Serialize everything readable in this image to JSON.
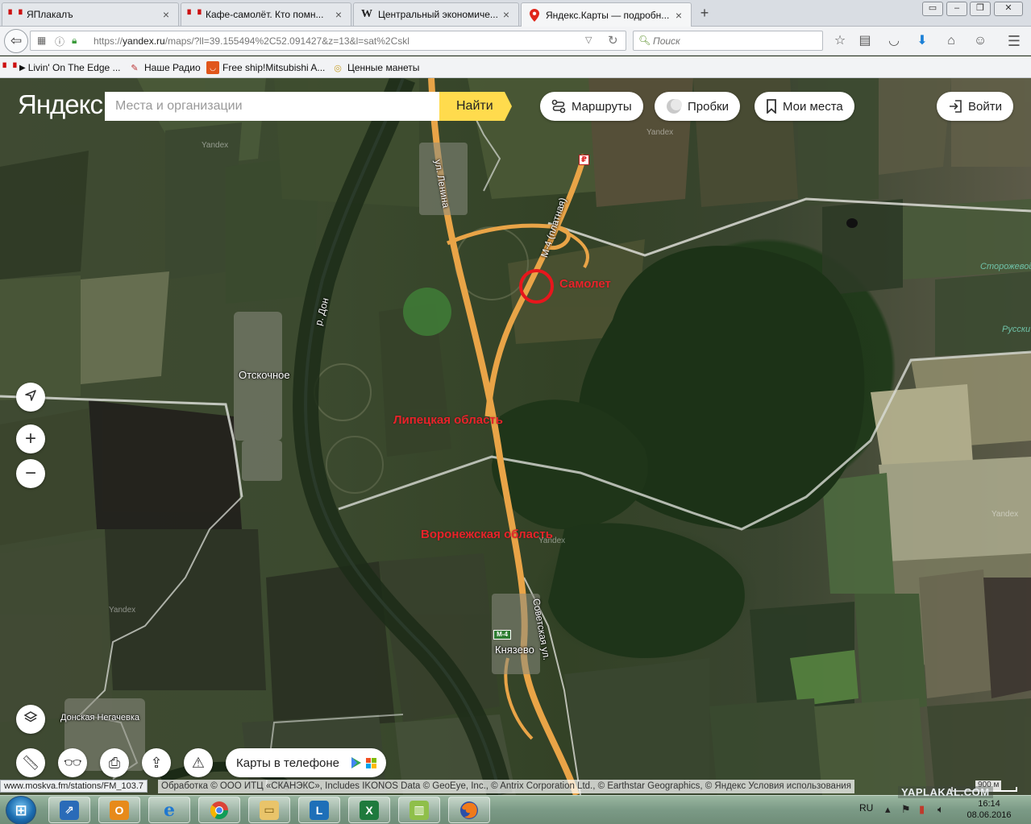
{
  "browser": {
    "tabs": [
      {
        "label": "ЯПлакалъ",
        "fav": "Я"
      },
      {
        "label": "Кафе-самолёт. Кто помн...",
        "fav": "Я"
      },
      {
        "label": "Центральный экономиче...",
        "fav": "W"
      },
      {
        "label": "Яндекс.Карты — подробн...",
        "fav": "pin",
        "active": true
      }
    ],
    "new_tab": "+",
    "url": "https://yandex.ru/maps/?ll=39.155494%2C52.091427&z=13&l=sat%2Cskl",
    "url_prefix": "https://",
    "url_domain": "yandex.ru",
    "url_rest": "/maps/?ll=39.155494%2C52.091427&z=13&l=sat%2Cskl",
    "search_placeholder": "Поиск",
    "bookmarks": [
      {
        "label": "Livin' On The Edge ..."
      },
      {
        "label": "Наше Радио"
      },
      {
        "label": "Free ship!Mitsubishi A..."
      },
      {
        "label": "Ценные манеты"
      }
    ]
  },
  "map": {
    "logo": "Яндекс",
    "search_placeholder": "Места и организации",
    "find_label": "Найти",
    "routes_label": "Маршруты",
    "traffic_label": "Пробки",
    "myplaces_label": "Мои места",
    "login_label": "Войти",
    "phone_label": "Карты в телефоне",
    "labels": {
      "lenina": "ул. Ленина",
      "m4": "М-4 (платная)",
      "samolet": "Самолет",
      "don": "р. Дон",
      "otskochnoe": "Отскочное",
      "lipetsk": "Липецкая область",
      "voronezh": "Воронежская область",
      "sovetskaya": "Советская ул.",
      "knyazevo": "Князево",
      "donskaya": "Донская Негачевка",
      "storozhevoy": "Сторожевой лес",
      "russkiy": "Русски",
      "m4_sign": "М-4",
      "rub": "₽",
      "watermark": "Yandex"
    },
    "status_url": "www.moskva.fm/stations/FM_103.7",
    "copyright": "Обработка © ООО ИТЦ «СКАНЭКС», Includes IKONOS Data © GeoEye, Inc., © Antrix Corporation Ltd., © Earthstar Geographics, © Яндекс",
    "terms": "Условия использования",
    "scale": "900 м"
  },
  "taskbar": {
    "lang": "RU",
    "time": "16:14",
    "date": "08.06.2016",
    "watermark": "YAPLAKAL.COM"
  }
}
